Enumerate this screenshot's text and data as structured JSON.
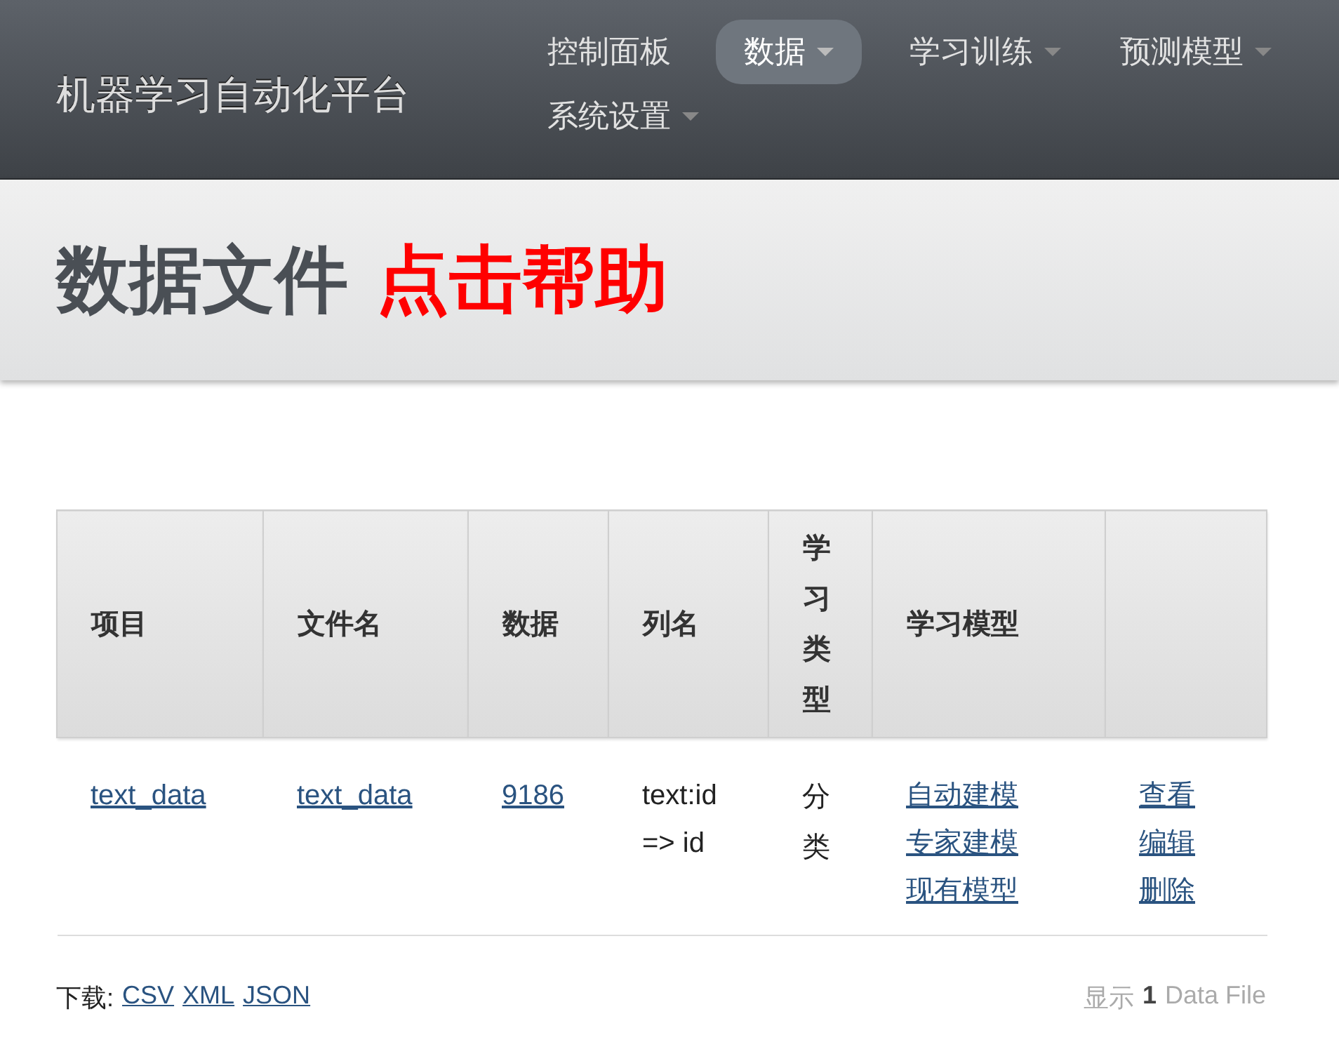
{
  "navbar": {
    "brand": "机器学习自动化平台",
    "items": [
      {
        "label": "控制面板",
        "selected": false,
        "dropdown": false
      },
      {
        "label": "数据",
        "selected": true,
        "dropdown": true
      },
      {
        "label": "学习训练",
        "selected": false,
        "dropdown": true
      },
      {
        "label": "预测模型",
        "selected": false,
        "dropdown": true
      },
      {
        "label": "系统设置",
        "selected": false,
        "dropdown": true
      }
    ]
  },
  "header": {
    "title": "数据文件",
    "help_link": "点击帮助"
  },
  "table": {
    "columns": [
      "项目",
      "文件名",
      "数据",
      "列名",
      "学习类型",
      "学习模型",
      ""
    ],
    "rows": [
      {
        "cells": [
          {
            "kind": "link",
            "texts": [
              "text_data"
            ]
          },
          {
            "kind": "link",
            "texts": [
              "text_data"
            ]
          },
          {
            "kind": "link",
            "texts": [
              "9186"
            ]
          },
          {
            "kind": "text",
            "texts": [
              "text:id => id"
            ]
          },
          {
            "kind": "vertical",
            "texts": [
              "分类"
            ]
          },
          {
            "kind": "links",
            "texts": [
              "自动建模",
              "专家建模",
              "现有模型"
            ]
          },
          {
            "kind": "links",
            "texts": [
              "查看",
              "编辑",
              "删除"
            ]
          }
        ]
      }
    ]
  },
  "footer": {
    "download_label": "下载:",
    "formats": [
      "CSV",
      "XML",
      "JSON"
    ],
    "count_prefix": "显示",
    "count": "1",
    "count_suffix": "Data File"
  }
}
